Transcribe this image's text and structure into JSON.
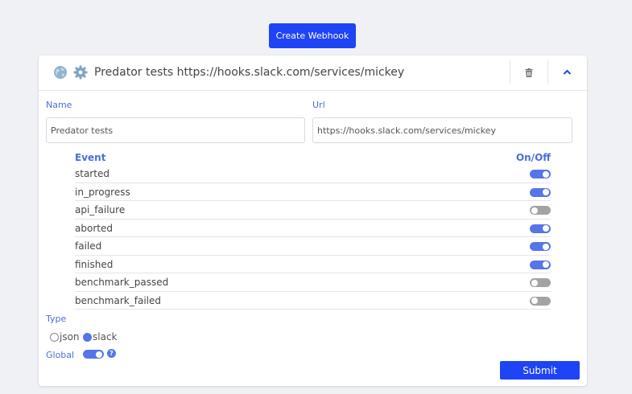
{
  "create_button": "Create Webhook",
  "header": {
    "title": "Predator tests https://hooks.slack.com/services/mickey",
    "icons": [
      "globe-icon",
      "gear-icon",
      "trash-icon",
      "chevron-up-icon"
    ]
  },
  "form": {
    "name_label": "Name",
    "name_value": "Predator tests",
    "url_label": "Url",
    "url_value": "https://hooks.slack.com/services/mickey"
  },
  "events": {
    "col_event": "Event",
    "col_onoff": "On/Off",
    "rows": [
      {
        "name": "started",
        "on": true
      },
      {
        "name": "in_progress",
        "on": true
      },
      {
        "name": "api_failure",
        "on": false
      },
      {
        "name": "aborted",
        "on": true
      },
      {
        "name": "failed",
        "on": true
      },
      {
        "name": "finished",
        "on": true
      },
      {
        "name": "benchmark_passed",
        "on": false
      },
      {
        "name": "benchmark_failed",
        "on": false
      }
    ]
  },
  "type": {
    "label": "Type",
    "options": [
      {
        "label": "json",
        "selected": false
      },
      {
        "label": "slack",
        "selected": true
      }
    ]
  },
  "global": {
    "label": "Global",
    "on": true,
    "help": "?"
  },
  "submit_button": "Submit",
  "colors": {
    "primary": "#1f44f5",
    "toggle_on": "#5476e8",
    "toggle_off": "#a3a3a3",
    "label": "#4a6fd8"
  }
}
